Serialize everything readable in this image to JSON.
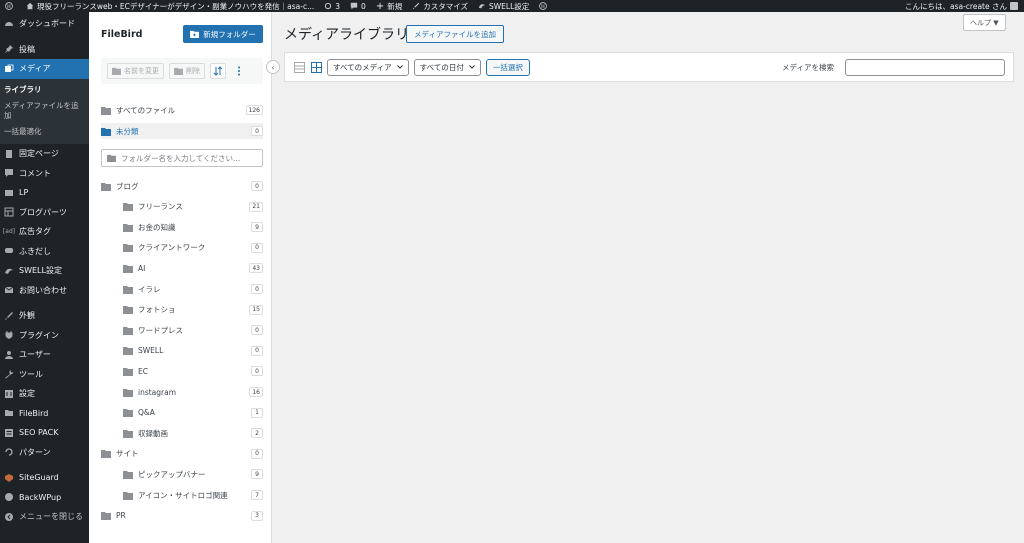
{
  "adminbar": {
    "site_name": "現役フリーランスweb・ECデザイナーがデザイン・副業ノウハウを発信｜asa-c...",
    "updates_count": "3",
    "comments_count": "0",
    "new_label": "新規",
    "customize_label": "カスタマイズ",
    "swell_label": "SWELL設定",
    "greeting": "こんにちは、asa-create さん"
  },
  "sidebar": {
    "dashboard": "ダッシュボード",
    "posts": "投稿",
    "media": "メディア",
    "sub_library": "ライブラリ",
    "sub_add": "メディアファイルを追加",
    "sub_optimize": "一括最適化",
    "pages": "固定ページ",
    "comments": "コメント",
    "lp": "LP",
    "blog_parts": "ブログパーツ",
    "ad_tag": "広告タグ",
    "fukidashi": "ふきだし",
    "swell_settings": "SWELL設定",
    "contact": "お問い合わせ",
    "appearance": "外観",
    "plugins": "プラグイン",
    "users": "ユーザー",
    "tools": "ツール",
    "settings": "設定",
    "filebird": "FileBird",
    "seo_pack": "SEO PACK",
    "patterns": "パターン",
    "siteguard": "SiteGuard",
    "backwpup": "BackWPup",
    "collapse": "メニューを閉じる"
  },
  "filebird": {
    "title": "FileBird",
    "new_folder": "新規フォルダー",
    "rename": "名前を変更",
    "delete": "削除",
    "all_files": "すべてのファイル",
    "all_count": "126",
    "uncategorized": "未分類",
    "uncategorized_count": "0",
    "search_placeholder": "フォルダー名を入力してください...",
    "folders": [
      {
        "name": "ブログ",
        "count": "0"
      },
      {
        "name": "フリーランス",
        "count": "21"
      },
      {
        "name": "お金の知識",
        "count": "9"
      },
      {
        "name": "クライアントワーク",
        "count": "0"
      },
      {
        "name": "AI",
        "count": "43"
      },
      {
        "name": "イラレ",
        "count": "0"
      },
      {
        "name": "フォトショ",
        "count": "15"
      },
      {
        "name": "ワードプレス",
        "count": "0"
      },
      {
        "name": "SWELL",
        "count": "0"
      },
      {
        "name": "EC",
        "count": "0"
      },
      {
        "name": "instagram",
        "count": "16"
      },
      {
        "name": "Q&A",
        "count": "1"
      },
      {
        "name": "収録動画",
        "count": "2"
      },
      {
        "name": "サイト",
        "count": "0"
      },
      {
        "name": "ピックアップバナー",
        "count": "9"
      },
      {
        "name": "アイコン・サイトロゴ関連",
        "count": "7"
      },
      {
        "name": "PR",
        "count": "3"
      }
    ]
  },
  "main": {
    "title": "メディアライブラリ",
    "add_new": "メディアファイルを追加",
    "help": "ヘルプ ▼",
    "filter_media": "すべてのメディア",
    "filter_date": "すべての日付",
    "bulk_select": "一括選択",
    "search_label": "メディアを検索"
  },
  "colors": {
    "accent": "#2271b1",
    "sidebar_bg": "#1d2327",
    "page_bg": "#f0f0f1"
  }
}
